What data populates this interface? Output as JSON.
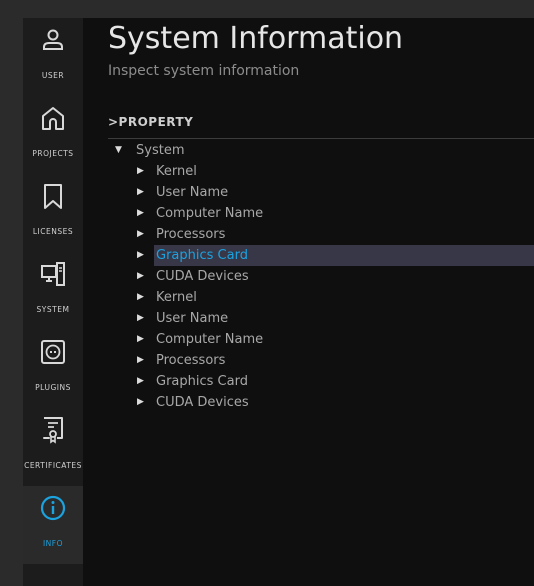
{
  "sidebar": {
    "items": [
      {
        "label": "USER",
        "icon": "user-icon"
      },
      {
        "label": "PROJECTS",
        "icon": "home-icon"
      },
      {
        "label": "LICENSES",
        "icon": "bookmark-icon"
      },
      {
        "label": "SYSTEM",
        "icon": "computer-icon"
      },
      {
        "label": "PLUGINS",
        "icon": "plugin-icon"
      },
      {
        "label": "CERTIFICATES",
        "icon": "certificate-icon"
      },
      {
        "label": "INFO",
        "icon": "info-icon",
        "active": true
      }
    ],
    "active_color": "#1ba3e0"
  },
  "main": {
    "title": "System Information",
    "subtitle": "Inspect system information",
    "column_header": ">PROPERTY",
    "tree": {
      "root": "System",
      "children": [
        "Kernel",
        "User Name",
        "Computer Name",
        "Processors",
        "Graphics Card",
        "CUDA Devices",
        "Kernel",
        "User Name",
        "Computer Name",
        "Processors",
        "Graphics Card",
        "CUDA Devices"
      ],
      "selected_index": 4
    }
  }
}
